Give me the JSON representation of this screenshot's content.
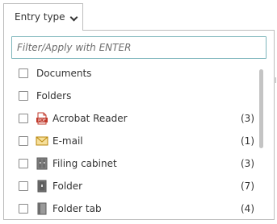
{
  "tab": {
    "label": "Entry type",
    "chevron_icon": "chevron-down-icon"
  },
  "filter": {
    "placeholder": "Filter/Apply with ENTER",
    "value": ""
  },
  "items": [
    {
      "label": "Documents",
      "count": "",
      "icon": ""
    },
    {
      "label": "Folders",
      "count": "",
      "icon": ""
    },
    {
      "label": "Acrobat Reader",
      "count": "(3)",
      "icon": "pdf-icon"
    },
    {
      "label": "E-mail",
      "count": "(1)",
      "icon": "envelope-icon"
    },
    {
      "label": "Filing cabinet",
      "count": "(3)",
      "icon": "filing-cabinet-icon"
    },
    {
      "label": "Folder",
      "count": "(7)",
      "icon": "folder-icon"
    },
    {
      "label": "Folder tab",
      "count": "(4)",
      "icon": "folder-tab-icon"
    }
  ],
  "pdf_icon_text": "PDF",
  "colors": {
    "accent_border": "#7eb6bc",
    "pdf_red": "#c0392b",
    "envelope_fill": "#f6df9a",
    "envelope_stroke": "#b8860b",
    "cabinet_gray": "#6d6d6d"
  }
}
